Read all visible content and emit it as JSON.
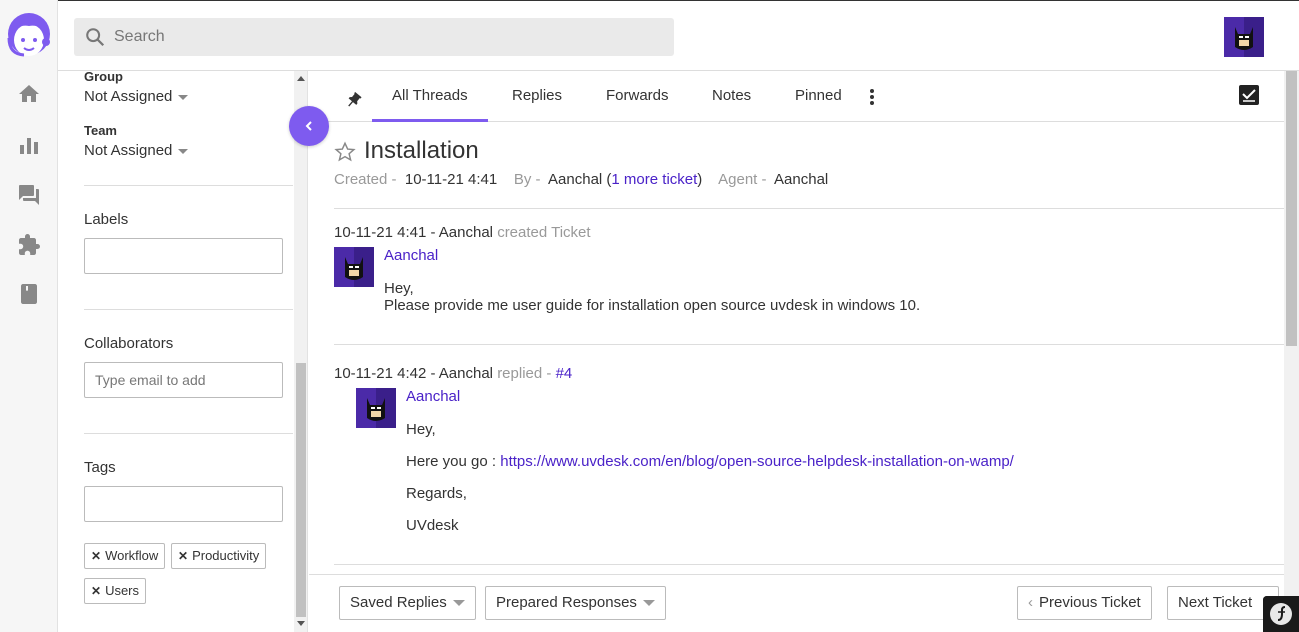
{
  "search": {
    "placeholder": "Search"
  },
  "side": {
    "group_label": "Group",
    "group_value": "Not Assigned",
    "team_label": "Team",
    "team_value": "Not Assigned",
    "labels_title": "Labels",
    "collaborators_title": "Collaborators",
    "collaborators_placeholder": "Type email to add",
    "tags_title": "Tags",
    "tags": [
      "Workflow",
      "Productivity",
      "Users"
    ]
  },
  "tabs": [
    "All Threads",
    "Replies",
    "Forwards",
    "Notes",
    "Pinned"
  ],
  "ticket": {
    "title": "Installation",
    "created_label": "Created -",
    "created_value": "10-11-21 4:41",
    "by_label": "By -",
    "by_value": "Aanchal",
    "more_ticket": "1 more ticket",
    "agent_label": "Agent -",
    "agent_value": "Aanchal"
  },
  "threads": [
    {
      "time_author": "10-11-21 4:41 - Aanchal",
      "action": "created Ticket",
      "name": "Aanchal",
      "lines": [
        "Hey,",
        "Please provide me user guide for installation open source uvdesk in windows 10."
      ]
    },
    {
      "time_author": "10-11-21 4:42 - Aanchal",
      "action": "replied -",
      "ref": "#4",
      "name": "Aanchal",
      "greeting": "Hey,",
      "link_prefix": "Here you go :",
      "link": "https://www.uvdesk.com/en/blog/open-source-helpdesk-installation-on-wamp/",
      "regards": "Regards,",
      "signature": "UVdesk"
    }
  ],
  "footer": {
    "saved_replies": "Saved Replies",
    "prepared_responses": "Prepared Responses",
    "previous": "Previous Ticket",
    "next": "Next Ticket"
  },
  "colors": {
    "accent": "#7e5bef",
    "link": "#4a22c8"
  }
}
